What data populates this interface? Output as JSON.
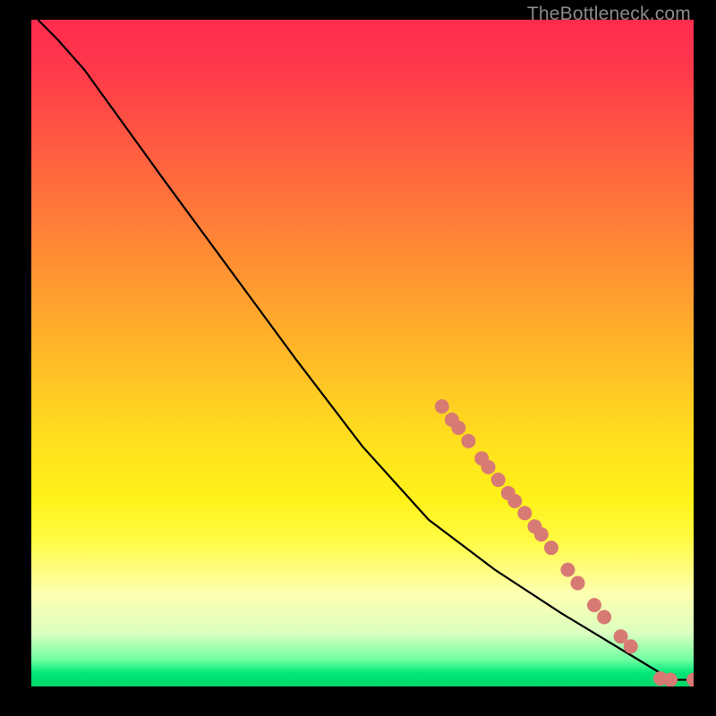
{
  "watermark": "TheBottleneck.com",
  "chart_data": {
    "type": "line",
    "title": "",
    "xlabel": "",
    "ylabel": "",
    "xlim": [
      0,
      100
    ],
    "ylim": [
      0,
      100
    ],
    "curve": [
      {
        "x": 1,
        "y": 100
      },
      {
        "x": 4,
        "y": 97
      },
      {
        "x": 8,
        "y": 92.5
      },
      {
        "x": 12,
        "y": 87
      },
      {
        "x": 20,
        "y": 76
      },
      {
        "x": 30,
        "y": 62.5
      },
      {
        "x": 40,
        "y": 49
      },
      {
        "x": 50,
        "y": 36
      },
      {
        "x": 60,
        "y": 25
      },
      {
        "x": 70,
        "y": 17.5
      },
      {
        "x": 80,
        "y": 11
      },
      {
        "x": 90,
        "y": 5
      },
      {
        "x": 95,
        "y": 2
      },
      {
        "x": 97,
        "y": 1
      },
      {
        "x": 100,
        "y": 1
      }
    ],
    "markers": [
      {
        "x": 62,
        "y": 42
      },
      {
        "x": 63.5,
        "y": 40
      },
      {
        "x": 64.5,
        "y": 38.8
      },
      {
        "x": 66,
        "y": 36.8
      },
      {
        "x": 68,
        "y": 34.2
      },
      {
        "x": 69,
        "y": 32.9
      },
      {
        "x": 70.5,
        "y": 31
      },
      {
        "x": 72,
        "y": 29
      },
      {
        "x": 73,
        "y": 27.8
      },
      {
        "x": 74.5,
        "y": 26
      },
      {
        "x": 76,
        "y": 24
      },
      {
        "x": 77,
        "y": 22.8
      },
      {
        "x": 78.5,
        "y": 20.8
      },
      {
        "x": 81,
        "y": 17.5
      },
      {
        "x": 82.5,
        "y": 15.5
      },
      {
        "x": 85,
        "y": 12.2
      },
      {
        "x": 86.5,
        "y": 10.4
      },
      {
        "x": 89,
        "y": 7.5
      },
      {
        "x": 90.5,
        "y": 6
      },
      {
        "x": 95,
        "y": 1.2
      },
      {
        "x": 96.5,
        "y": 1
      },
      {
        "x": 100,
        "y": 1
      }
    ],
    "marker_color": "#d87a74",
    "curve_color": "#000000"
  }
}
